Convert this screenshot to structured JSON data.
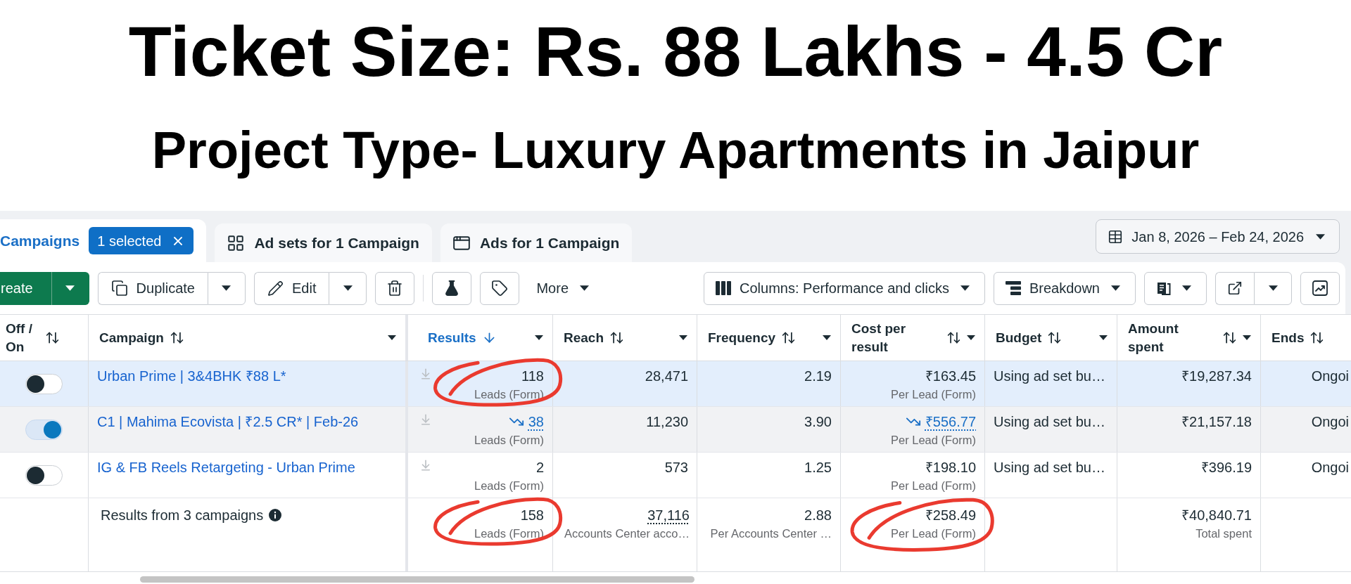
{
  "banner": {
    "title": "Ticket Size: Rs. 88 Lakhs - 4.5 Cr",
    "subtitle": "Project Type- Luxury Apartments in Jaipur"
  },
  "tabs": [
    {
      "kind": "campaigns",
      "label": "Campaigns",
      "selected": true,
      "badge": "1 selected"
    },
    {
      "kind": "ad_sets",
      "label": "Ad sets for 1 Campaign",
      "selected": false
    },
    {
      "kind": "ads",
      "label": "Ads for 1 Campaign",
      "selected": false
    }
  ],
  "date_range": {
    "label": "Jan 8, 2026 – Feb 24, 2026"
  },
  "toolbar": {
    "groups": [
      [
        {
          "kind": "create",
          "label": "reate"
        },
        {
          "kind": "duplicate",
          "label": "Duplicate"
        },
        {
          "kind": "edit",
          "label": "Edit"
        },
        {
          "kind": "delete"
        }
      ],
      [
        {
          "kind": "test"
        },
        {
          "kind": "tag"
        },
        {
          "kind": "more",
          "label": "More"
        }
      ]
    ],
    "right": [
      {
        "kind": "columns",
        "label": "Columns: Performance and clicks"
      },
      {
        "kind": "breakdown",
        "label": "Breakdown"
      },
      {
        "kind": "reports"
      },
      {
        "kind": "export"
      },
      {
        "kind": "charts"
      }
    ]
  },
  "table": {
    "columns": [
      {
        "label": "Off / On",
        "sorted": false,
        "menu": false
      },
      {
        "label": "Campaign",
        "sorted": false,
        "menu": true
      },
      {
        "label": "Results",
        "sorted": true,
        "menu": true
      },
      {
        "label": "Reach",
        "sorted": false,
        "menu": true
      },
      {
        "label": "Frequency",
        "sorted": false,
        "menu": true
      },
      {
        "label": "Cost per result",
        "sorted": false,
        "menu": true
      },
      {
        "label": "Budget",
        "sorted": false,
        "menu": true
      },
      {
        "label": "Amount spent",
        "sorted": false,
        "menu": true
      },
      {
        "label": "Ends",
        "sorted": false,
        "menu": false
      }
    ],
    "rows": [
      {
        "selected": true,
        "hovered": false,
        "on": false,
        "campaign": "Urban Prime | 3&4BHK ₹88 L*",
        "results": {
          "value": "118",
          "label": "Leads (Form)",
          "trend_down": false,
          "circled": true
        },
        "reach": "28,471",
        "frequency": "2.19",
        "cost_per_result": {
          "value": "₹163.45",
          "label": "Per Lead (Form)",
          "trend_down": false,
          "circled": false
        },
        "budget": "Using ad set bu…",
        "amount_spent": "₹19,287.34",
        "ends": "Ongoi"
      },
      {
        "selected": false,
        "hovered": true,
        "on": true,
        "campaign": "C1 | Mahima Ecovista | ₹2.5 CR* | Feb-26",
        "results": {
          "value": "38",
          "label": "Leads (Form)",
          "trend_down": true,
          "circled": false
        },
        "reach": "11,230",
        "frequency": "3.90",
        "cost_per_result": {
          "value": "₹556.77",
          "label": "Per Lead (Form)",
          "trend_down": true,
          "circled": false
        },
        "budget": "Using ad set bu…",
        "amount_spent": "₹21,157.18",
        "ends": "Ongoi"
      },
      {
        "selected": false,
        "hovered": false,
        "on": false,
        "campaign": "IG & FB Reels Retargeting - Urban Prime",
        "results": {
          "value": "2",
          "label": "Leads (Form)",
          "trend_down": false,
          "circled": false
        },
        "reach": "573",
        "frequency": "1.25",
        "cost_per_result": {
          "value": "₹198.10",
          "label": "Per Lead (Form)",
          "trend_down": false,
          "circled": false
        },
        "budget": "Using ad set bu…",
        "amount_spent": "₹396.19",
        "ends": "Ongoi"
      }
    ],
    "summary": {
      "label": "Results from 3 campaigns",
      "results": {
        "value": "158",
        "label": "Leads (Form)",
        "circled": true
      },
      "reach": {
        "value": "37,116",
        "label": "Accounts Center acco…"
      },
      "frequency": {
        "value": "2.88",
        "label": "Per Accounts Center …"
      },
      "cost_per_result": {
        "value": "₹258.49",
        "label": "Per Lead (Form)",
        "circled": true
      },
      "amount_spent": {
        "value": "₹40,840.71",
        "label": "Total spent"
      }
    }
  }
}
